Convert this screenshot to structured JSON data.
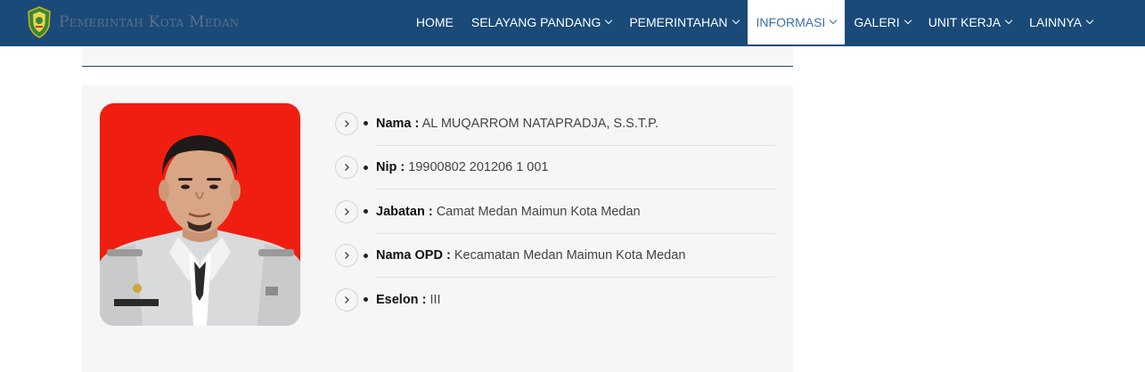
{
  "header": {
    "brand_text": "Pemerintah Kota Medan",
    "nav": [
      {
        "label": "HOME",
        "has_dropdown": false
      },
      {
        "label": "SELAYANG PANDANG",
        "has_dropdown": true
      },
      {
        "label": "PEMERINTAHAN",
        "has_dropdown": true
      },
      {
        "label": "INFORMASI",
        "has_dropdown": true,
        "active": true
      },
      {
        "label": "GALERI",
        "has_dropdown": true
      },
      {
        "label": "UNIT KERJA",
        "has_dropdown": true
      },
      {
        "label": "LAINNYA",
        "has_dropdown": true
      }
    ]
  },
  "profile": {
    "fields": [
      {
        "label": "Nama :",
        "value": "AL MUQARROM NATAPRADJA, S.S.T.P."
      },
      {
        "label": "Nip :",
        "value": "19900802 201206 1 001"
      },
      {
        "label": "Jabatan :",
        "value": "Camat Medan Maimun Kota Medan"
      },
      {
        "label": "Nama OPD :",
        "value": "Kecamatan Medan Maimun Kota Medan"
      },
      {
        "label": "Eselon :",
        "value": "III"
      }
    ]
  },
  "colors": {
    "navbar": "#1a4a78",
    "active_nav_text": "#3a6fa8",
    "photo_background": "#f01e10",
    "card_background": "#f6f6f6"
  },
  "icons": {
    "logo": "city-emblem-icon",
    "caret": "chevron-down-icon",
    "row_button": "chevron-right-icon"
  }
}
